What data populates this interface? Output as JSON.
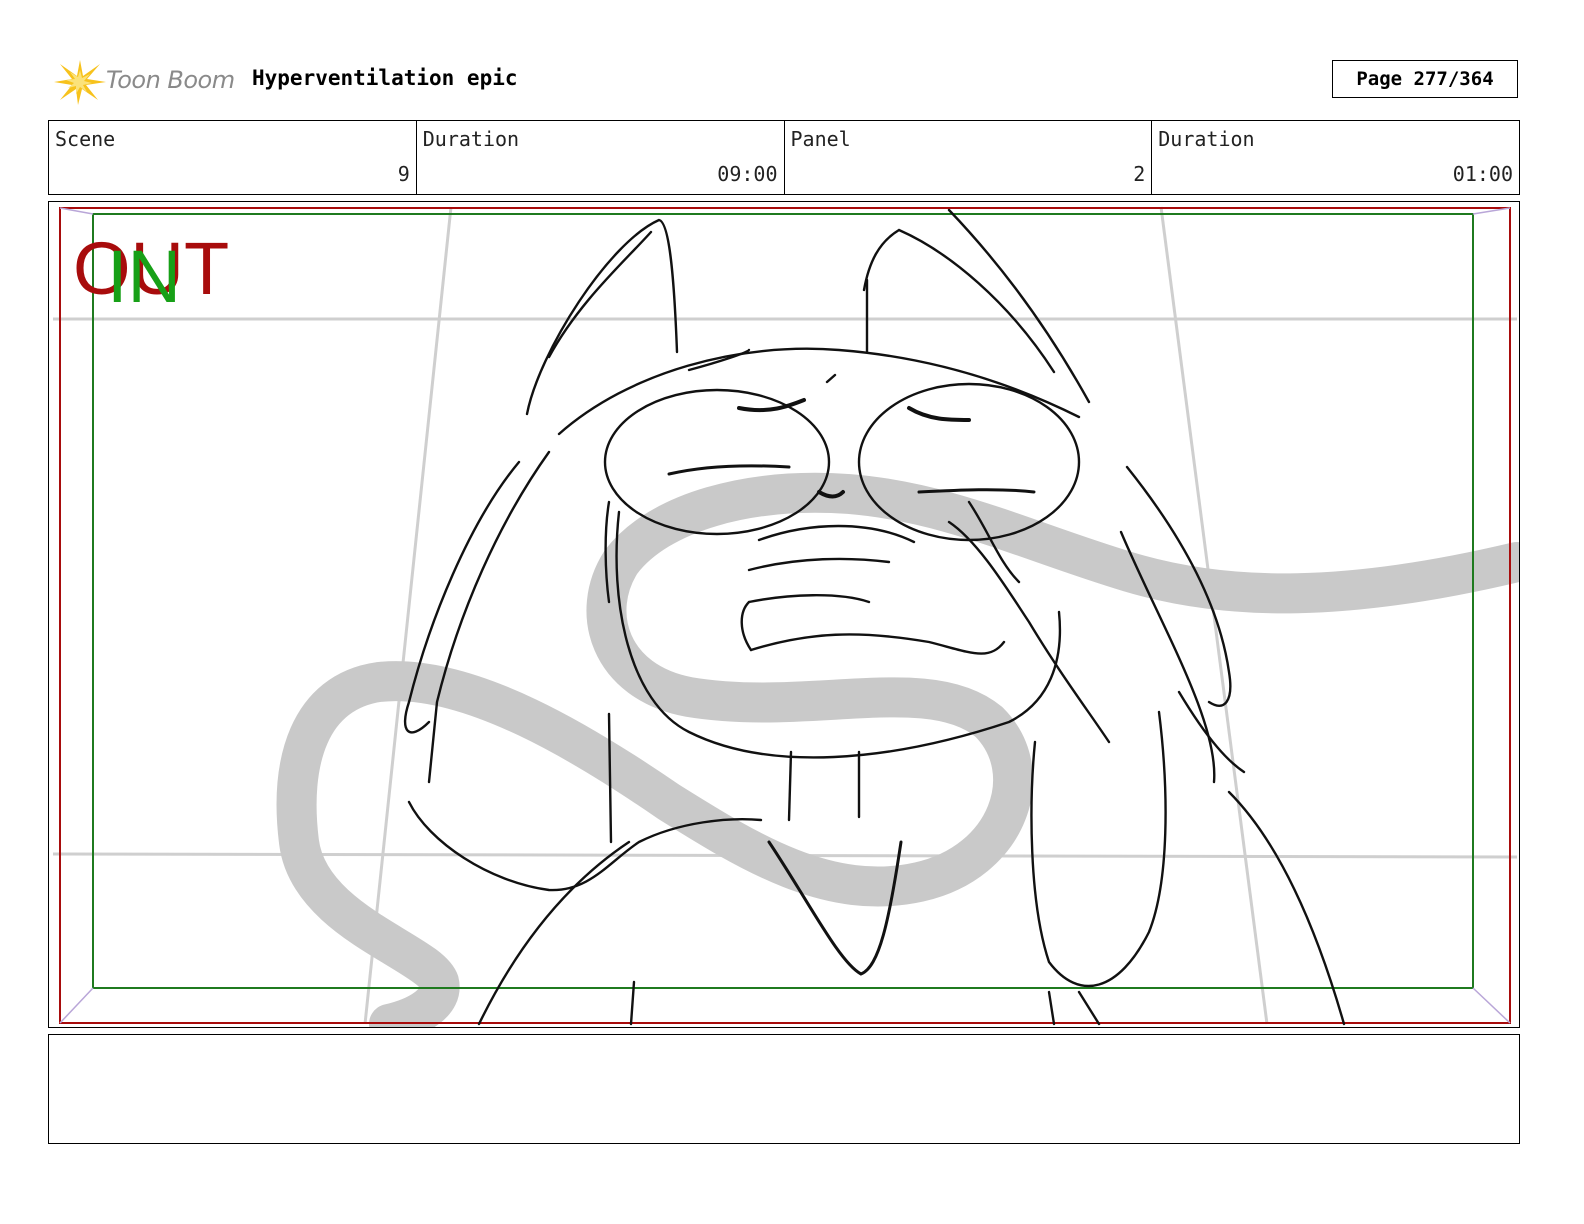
{
  "header": {
    "logo_text": "Toon Boom",
    "title": "Hyperventilation epic",
    "page_label": "Page 277/364"
  },
  "info": {
    "scene_label": "Scene",
    "scene_value": "9",
    "scene_duration_label": "Duration",
    "scene_duration_value": "09:00",
    "panel_label": "Panel",
    "panel_value": "2",
    "panel_duration_label": "Duration",
    "panel_duration_value": "01:00"
  },
  "panel": {
    "out_label": "OUT",
    "in_label": "IN",
    "colors": {
      "out_frame": "#a80c0c",
      "in_frame": "#1f7a1f",
      "guide": "#c8c8c8"
    }
  },
  "notes": {
    "text": ""
  }
}
